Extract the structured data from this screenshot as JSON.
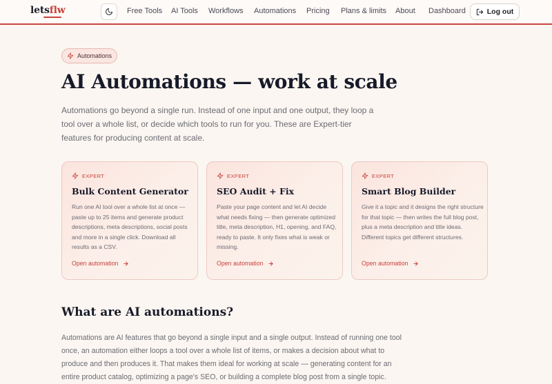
{
  "header": {
    "logo_prefix": "lets",
    "logo_suffix": "flw",
    "nav": [
      {
        "label": "Free Tools"
      },
      {
        "label": "AI Tools"
      },
      {
        "label": "Workflows"
      },
      {
        "label": "Automations"
      },
      {
        "label": "Pricing"
      },
      {
        "label": "Plans & limits"
      },
      {
        "label": "About"
      },
      {
        "label": "Dashboard"
      }
    ],
    "logout_label": "Log out"
  },
  "hero": {
    "pill_label": "Automations",
    "title": "AI Automations — work at scale",
    "description": "Automations go beyond a single run. Instead of one input and one output, they loop a tool over a whole list, or decide which tools to run for you. These are Expert-tier features for producing content at scale."
  },
  "cards": [
    {
      "badge": "EXPERT",
      "title": "Bulk Content Generator",
      "description": "Run one AI tool over a whole list at once — paste up to 25 items and generate product descriptions, meta descriptions, social posts and more in a single click. Download all results as a CSV.",
      "link": "Open automation"
    },
    {
      "badge": "EXPERT",
      "title": "SEO Audit + Fix",
      "description": "Paste your page content and let AI decide what needs fixing — then generate optimized title, meta description, H1, opening, and FAQ, ready to paste. It only fixes what is weak or missing.",
      "link": "Open automation"
    },
    {
      "badge": "EXPERT",
      "title": "Smart Blog Builder",
      "description": "Give it a topic and it designs the right structure for that topic — then writes the full blog post, plus a meta description and title ideas. Different topics get different structures.",
      "link": "Open automation"
    }
  ],
  "section": {
    "title": "What are AI automations?",
    "body": "Automations are AI features that go beyond a single input and a single output. Instead of running one tool once, an automation either loops a tool over a whole list of items, or makes a decision about what to produce and then produces it. That makes them ideal for working at scale — generating content for an entire product catalog, optimizing a page's SEO, or building a complete blog post from a single topic."
  },
  "colors": {
    "accent": "#c8413b",
    "background": "#fbf6f1",
    "heading": "#171a29",
    "muted_text": "#6b6b73"
  },
  "icons": [
    "moon-icon",
    "logout-icon",
    "lightning-icon",
    "arrow-right-icon"
  ]
}
